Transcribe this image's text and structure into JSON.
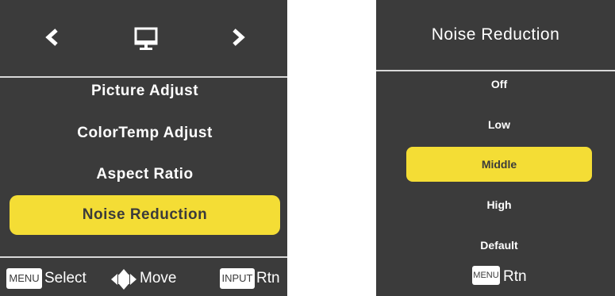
{
  "main_menu": {
    "items": [
      {
        "label": "Picture Adjust"
      },
      {
        "label": "ColorTemp Adjust"
      },
      {
        "label": "Aspect Ratio"
      },
      {
        "label": "Noise Reduction"
      }
    ],
    "selected_index": 3,
    "footer": {
      "menu_key": "MENU",
      "select_label": "Select",
      "move_label": "Move",
      "input_key": "INPUT",
      "return_label": "Rtn"
    },
    "icons": {
      "prev": "chevron-left-icon",
      "category": "monitor-icon",
      "next": "chevron-right-icon",
      "move": "arrows-move-icon"
    }
  },
  "noise_reduction": {
    "title": "Noise Reduction",
    "options": [
      {
        "label": "Off"
      },
      {
        "label": "Low"
      },
      {
        "label": "Middle"
      },
      {
        "label": "High"
      },
      {
        "label": "Default"
      }
    ],
    "selected_index": 2,
    "footer": {
      "menu_key": "MENU",
      "return_label": "Rtn"
    }
  },
  "colors": {
    "panel": "#3b3b3b",
    "highlight": "#f4dd35",
    "text": "#ffffff"
  }
}
